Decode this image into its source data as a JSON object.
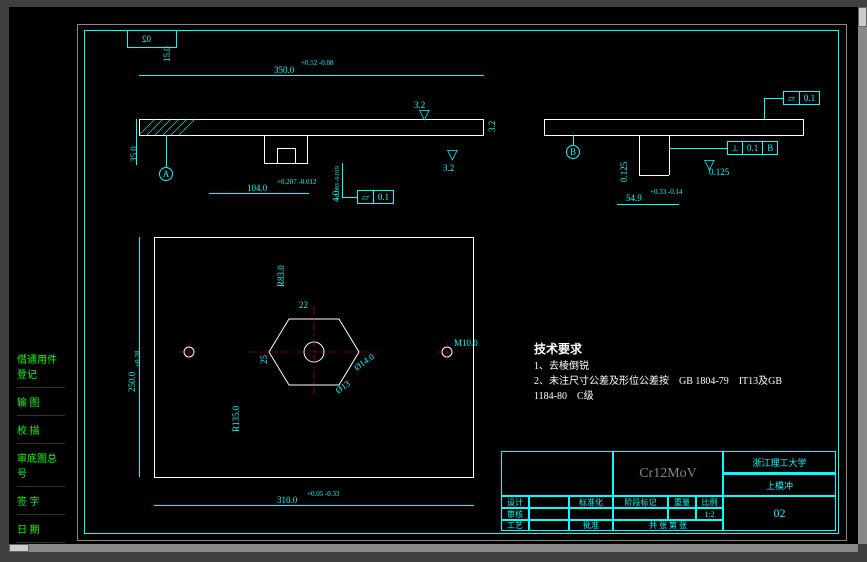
{
  "sheet_number_top": "02",
  "left_tabs": {
    "t0": "借通用件登记",
    "t1": "输 图",
    "t2": "校 描",
    "t3": "审底图总号",
    "t4": "签 字",
    "t5": "日 期"
  },
  "dims": {
    "d350": "350.0",
    "d350tol": "+0.52\n-0.08",
    "d15": "15.0",
    "d35": "35.0",
    "d104": "104.0",
    "d104tol": "+0.207\n-0.012",
    "d4": "4.0",
    "d4tol": "+0.083\n-0.019",
    "d250": "250.0",
    "d250tol": "+0.28",
    "d310": "310.0",
    "d310tol": "+0.05\n-0.33",
    "d549": "54.9",
    "d549tol": "+0.33\n-0.14",
    "d0125": "0.125",
    "d0125b": "0.125",
    "r83": "R83.0",
    "r135": "R135.0",
    "d22": "22",
    "d25": "25",
    "phi14": "Ø14.0",
    "phi13": "Ø13",
    "m10": "M10.0",
    "sf32a": "3.2",
    "sf32b": "3.2",
    "sf32c": "3.2"
  },
  "gdtt": {
    "g1sym": "⏥",
    "g1val": "0.1",
    "g2sym": "⏥",
    "g2val": "0.1",
    "g3sym": "⟂",
    "g3val": "0.1",
    "g3ref": "B"
  },
  "datum": {
    "A": "A",
    "B": "B"
  },
  "notes": {
    "title": "技术要求",
    "n1": "1、去棱倒锐",
    "n2": "2、未注尺寸公差及形位公差按　GB 1804-79　IT13及GB",
    "n3": "1184-80　C级"
  },
  "title_block": {
    "material": "Cr12MoV",
    "school": "浙江理工大学",
    "partname": "上模冲",
    "sheetno": "02",
    "hdr1": "设计",
    "hdr2": "标准化",
    "hdr3": "阶段标记",
    "hdr4": "重量",
    "hdr5": "比例",
    "hdr6": "审核",
    "hdr7": "工艺",
    "hdr8": "批准",
    "scale": "1:2",
    "sheet": "共  张  第  张"
  }
}
